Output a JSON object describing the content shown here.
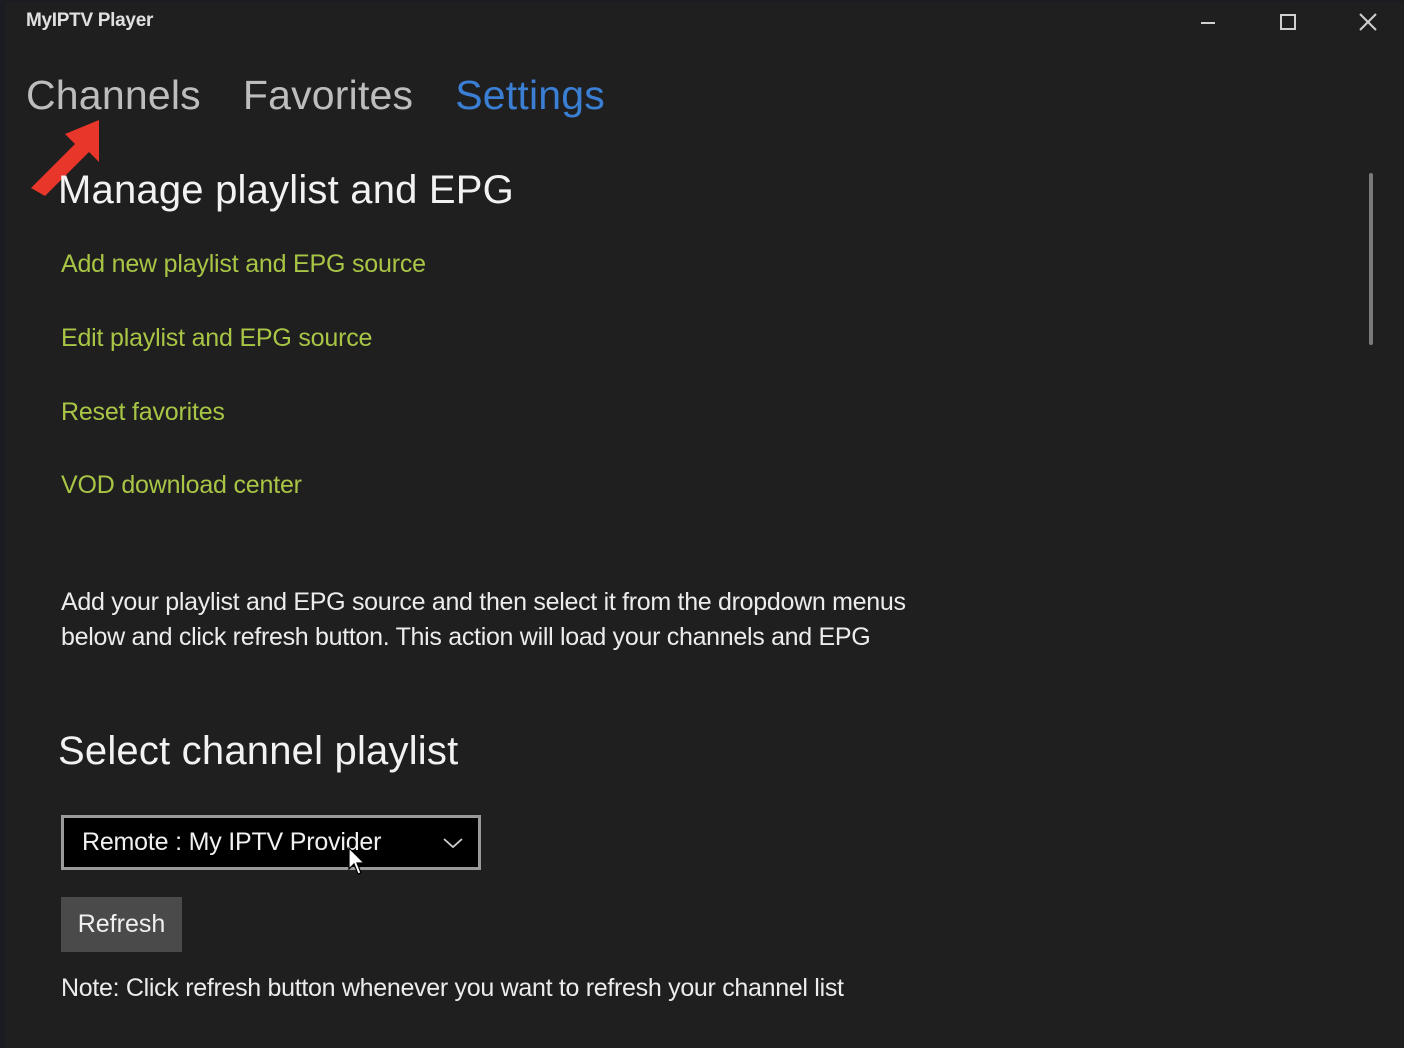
{
  "window": {
    "title": "MyIPTV Player",
    "controls": {
      "minimize_icon": "minimize-icon",
      "maximize_icon": "maximize-icon",
      "close_icon": "close-icon"
    }
  },
  "tabs": [
    {
      "label": "Channels",
      "active": false
    },
    {
      "label": "Favorites",
      "active": false
    },
    {
      "label": "Settings",
      "active": true
    }
  ],
  "annotation": {
    "type": "red-arrow",
    "points_to": "Channels",
    "color": "#e8372a"
  },
  "manage_section": {
    "title": "Manage playlist and EPG",
    "links": [
      {
        "label": "Add new playlist and EPG source"
      },
      {
        "label": "Edit playlist and EPG source"
      },
      {
        "label": "Reset favorites"
      },
      {
        "label": "VOD download center"
      }
    ]
  },
  "description": "Add your playlist and EPG source and then select it from the dropdown menus below and click refresh button. This action will load your channels and EPG",
  "playlist_section": {
    "title": "Select channel playlist",
    "dropdown": {
      "selected": "Remote : My IPTV Provider",
      "icon": "chevron-down-icon"
    },
    "refresh_label": "Refresh",
    "note": "Note: Click refresh button whenever you want to refresh your channel list"
  },
  "colors": {
    "background": "#1f1f1f",
    "accent_tab": "#3a7fd4",
    "link": "#a8c545",
    "arrow": "#e8372a",
    "button": "#4a4a4a"
  }
}
